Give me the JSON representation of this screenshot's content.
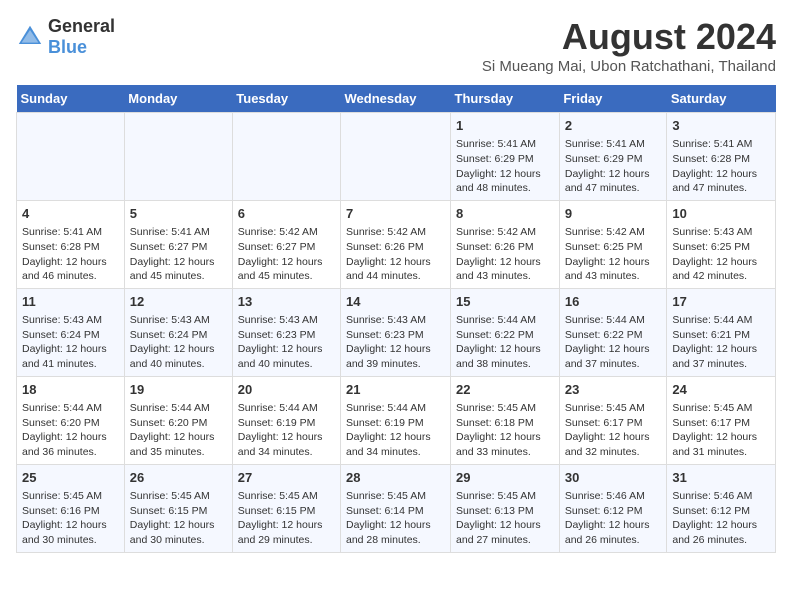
{
  "logo": {
    "general": "General",
    "blue": "Blue"
  },
  "title": {
    "month_year": "August 2024",
    "location": "Si Mueang Mai, Ubon Ratchathani, Thailand"
  },
  "days_of_week": [
    "Sunday",
    "Monday",
    "Tuesday",
    "Wednesday",
    "Thursday",
    "Friday",
    "Saturday"
  ],
  "weeks": [
    [
      {
        "day": "",
        "info": ""
      },
      {
        "day": "",
        "info": ""
      },
      {
        "day": "",
        "info": ""
      },
      {
        "day": "",
        "info": ""
      },
      {
        "day": "1",
        "info": "Sunrise: 5:41 AM\nSunset: 6:29 PM\nDaylight: 12 hours and 48 minutes."
      },
      {
        "day": "2",
        "info": "Sunrise: 5:41 AM\nSunset: 6:29 PM\nDaylight: 12 hours and 47 minutes."
      },
      {
        "day": "3",
        "info": "Sunrise: 5:41 AM\nSunset: 6:28 PM\nDaylight: 12 hours and 47 minutes."
      }
    ],
    [
      {
        "day": "4",
        "info": "Sunrise: 5:41 AM\nSunset: 6:28 PM\nDaylight: 12 hours and 46 minutes."
      },
      {
        "day": "5",
        "info": "Sunrise: 5:41 AM\nSunset: 6:27 PM\nDaylight: 12 hours and 45 minutes."
      },
      {
        "day": "6",
        "info": "Sunrise: 5:42 AM\nSunset: 6:27 PM\nDaylight: 12 hours and 45 minutes."
      },
      {
        "day": "7",
        "info": "Sunrise: 5:42 AM\nSunset: 6:26 PM\nDaylight: 12 hours and 44 minutes."
      },
      {
        "day": "8",
        "info": "Sunrise: 5:42 AM\nSunset: 6:26 PM\nDaylight: 12 hours and 43 minutes."
      },
      {
        "day": "9",
        "info": "Sunrise: 5:42 AM\nSunset: 6:25 PM\nDaylight: 12 hours and 43 minutes."
      },
      {
        "day": "10",
        "info": "Sunrise: 5:43 AM\nSunset: 6:25 PM\nDaylight: 12 hours and 42 minutes."
      }
    ],
    [
      {
        "day": "11",
        "info": "Sunrise: 5:43 AM\nSunset: 6:24 PM\nDaylight: 12 hours and 41 minutes."
      },
      {
        "day": "12",
        "info": "Sunrise: 5:43 AM\nSunset: 6:24 PM\nDaylight: 12 hours and 40 minutes."
      },
      {
        "day": "13",
        "info": "Sunrise: 5:43 AM\nSunset: 6:23 PM\nDaylight: 12 hours and 40 minutes."
      },
      {
        "day": "14",
        "info": "Sunrise: 5:43 AM\nSunset: 6:23 PM\nDaylight: 12 hours and 39 minutes."
      },
      {
        "day": "15",
        "info": "Sunrise: 5:44 AM\nSunset: 6:22 PM\nDaylight: 12 hours and 38 minutes."
      },
      {
        "day": "16",
        "info": "Sunrise: 5:44 AM\nSunset: 6:22 PM\nDaylight: 12 hours and 37 minutes."
      },
      {
        "day": "17",
        "info": "Sunrise: 5:44 AM\nSunset: 6:21 PM\nDaylight: 12 hours and 37 minutes."
      }
    ],
    [
      {
        "day": "18",
        "info": "Sunrise: 5:44 AM\nSunset: 6:20 PM\nDaylight: 12 hours and 36 minutes."
      },
      {
        "day": "19",
        "info": "Sunrise: 5:44 AM\nSunset: 6:20 PM\nDaylight: 12 hours and 35 minutes."
      },
      {
        "day": "20",
        "info": "Sunrise: 5:44 AM\nSunset: 6:19 PM\nDaylight: 12 hours and 34 minutes."
      },
      {
        "day": "21",
        "info": "Sunrise: 5:44 AM\nSunset: 6:19 PM\nDaylight: 12 hours and 34 minutes."
      },
      {
        "day": "22",
        "info": "Sunrise: 5:45 AM\nSunset: 6:18 PM\nDaylight: 12 hours and 33 minutes."
      },
      {
        "day": "23",
        "info": "Sunrise: 5:45 AM\nSunset: 6:17 PM\nDaylight: 12 hours and 32 minutes."
      },
      {
        "day": "24",
        "info": "Sunrise: 5:45 AM\nSunset: 6:17 PM\nDaylight: 12 hours and 31 minutes."
      }
    ],
    [
      {
        "day": "25",
        "info": "Sunrise: 5:45 AM\nSunset: 6:16 PM\nDaylight: 12 hours and 30 minutes."
      },
      {
        "day": "26",
        "info": "Sunrise: 5:45 AM\nSunset: 6:15 PM\nDaylight: 12 hours and 30 minutes."
      },
      {
        "day": "27",
        "info": "Sunrise: 5:45 AM\nSunset: 6:15 PM\nDaylight: 12 hours and 29 minutes."
      },
      {
        "day": "28",
        "info": "Sunrise: 5:45 AM\nSunset: 6:14 PM\nDaylight: 12 hours and 28 minutes."
      },
      {
        "day": "29",
        "info": "Sunrise: 5:45 AM\nSunset: 6:13 PM\nDaylight: 12 hours and 27 minutes."
      },
      {
        "day": "30",
        "info": "Sunrise: 5:46 AM\nSunset: 6:12 PM\nDaylight: 12 hours and 26 minutes."
      },
      {
        "day": "31",
        "info": "Sunrise: 5:46 AM\nSunset: 6:12 PM\nDaylight: 12 hours and 26 minutes."
      }
    ]
  ]
}
